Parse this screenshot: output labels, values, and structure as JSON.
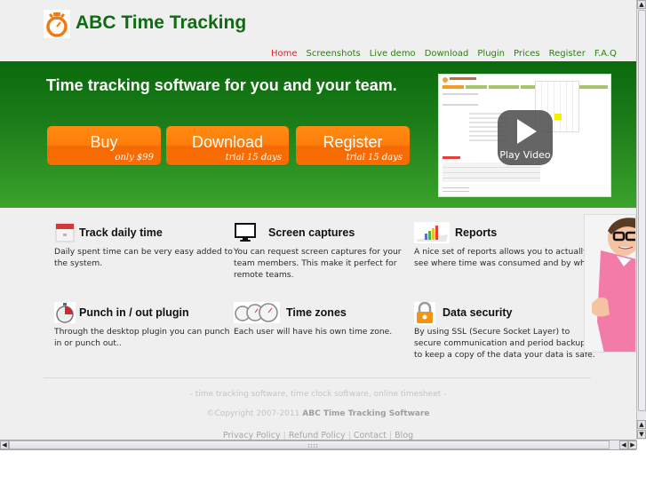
{
  "header": {
    "logo_alt": "stopwatch logo",
    "title": "ABC Time Tracking"
  },
  "nav": {
    "items": [
      {
        "label": "Home",
        "active": true
      },
      {
        "label": "Screenshots",
        "active": false
      },
      {
        "label": "Live demo",
        "active": false
      },
      {
        "label": "Download",
        "active": false
      },
      {
        "label": "Plugin",
        "active": false
      },
      {
        "label": "Prices",
        "active": false
      },
      {
        "label": "Register",
        "active": false
      },
      {
        "label": "F.A.Q",
        "active": false
      }
    ]
  },
  "banner": {
    "headline": "Time tracking software for you and your team.",
    "buttons": {
      "buy": {
        "label": "Buy",
        "sub": "only $99"
      },
      "download": {
        "label": "Download",
        "sub": "trial 15 days"
      },
      "register": {
        "label": "Register",
        "sub": "trial 15 days"
      }
    },
    "video": {
      "play_label": "Play Video"
    }
  },
  "features": [
    {
      "icon": "calendar-icon",
      "title": "Track daily time",
      "text": "Daily spent time can be very easy added to the system."
    },
    {
      "icon": "monitor-icon",
      "title": "Screen captures",
      "text": "You can request screen captures for your team members. This make it perfect for remote teams."
    },
    {
      "icon": "bar-chart-icon",
      "title": "Reports",
      "text": "A nice set of reports allows you to actually see where time was consumed and by who."
    },
    {
      "icon": "stopwatch-icon",
      "title": "Punch in / out plugin",
      "text": "Through the desktop plugin you can punch in or punch out.."
    },
    {
      "icon": "clocks-icon",
      "title": "Time zones",
      "text": "Each user will have his own time zone."
    },
    {
      "icon": "padlock-icon",
      "title": "Data security",
      "text": "By using SSL (Secure Socket Layer) to secure communication and period backups to keep a copy of the data your data is safe."
    }
  ],
  "footer": {
    "tagline": "- time tracking software, time clock software, online timesheet -",
    "copyright": "©Copyright 2007-2011",
    "company": "ABC Time Tracking Software",
    "links": [
      "Privacy Policy",
      "Refund Policy",
      "Contact",
      "Blog"
    ],
    "separator": "|"
  },
  "colors": {
    "brand_green": "#0f6b12",
    "nav_green": "#2f7d14",
    "nav_active": "#e0222a",
    "cta_orange": "#ff7d0a"
  }
}
